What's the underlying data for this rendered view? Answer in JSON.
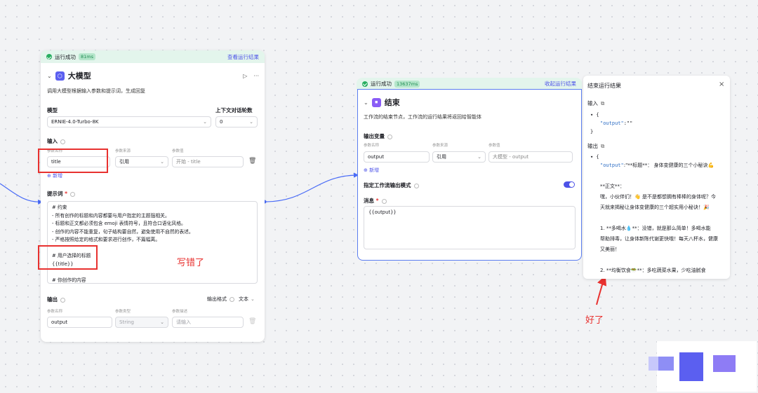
{
  "llm_node": {
    "status": "运行成功",
    "time": "81ms",
    "view_result": "查看运行结果",
    "title": "大模型",
    "description": "调用大模型根据输入参数和提示词，生成回复",
    "model_label": "模型",
    "model_value": "ERNIE-4.0-Turbo-8K",
    "context_label": "上下文对话轮数",
    "context_value": "0",
    "input_label": "输入",
    "col_name": "参数名称",
    "col_source": "参数来源",
    "col_value": "参数值",
    "input_param": "title",
    "input_source": "引用",
    "input_ref": "开始 - title",
    "add_label": "新增",
    "prompt_label": "提示词",
    "prompt_lines": [
      "# 约束",
      "- 所有创作的标题和内容都要与用户指定的主题强相关。",
      "- 标题和正文都必须包含 emoji 表情符号，且符合口语化风格。",
      "- 创作的内容不能重复，句子结构要自然，避免使用不自然的表述。",
      "- 严格按照给定的格式和要求进行创作，不篇幅离。",
      "",
      "# 用户选择的标题",
      "{{title}}",
      "",
      "# 你创作的内容"
    ],
    "output_label": "输出",
    "output_format_label": "输出格式",
    "output_format_value": "文本",
    "col_type": "参数类型",
    "col_desc": "参数描述",
    "output_param": "output",
    "output_type": "String",
    "output_desc_placeholder": "请输入"
  },
  "end_node": {
    "status": "运行成功",
    "time": "13637ms",
    "collapse_result": "收起运行结果",
    "title": "结束",
    "description": "工作流的结束节点，工作流的运行结果将返回给智能体",
    "output_var_label": "输出变量",
    "col_name": "参数名称",
    "col_source": "参数来源",
    "col_value": "参数值",
    "param": "output",
    "source": "引用",
    "ref": "大模型 - output",
    "add_label": "新增",
    "stream_label": "指定工作流输出模式",
    "stream_on": true,
    "message_label": "消息",
    "message_value": "{{output}}"
  },
  "result_panel": {
    "title": "结束运行结果",
    "input_label": "输入",
    "input_key": "\"output\"",
    "input_val": ":\"\"",
    "output_label": "输出",
    "output_key": "\"output\"",
    "output_val": ":\"**标题**：  身体变健康的三个小秘诀💪",
    "lines": [
      "**正文**：",
      "嘿，小伙伴们！👋 是不是都想拥有棒棒的身体呢？今",
      "天就来揭秘让身体变健康的三个超实用小秘诀！🎉",
      "",
      "1. **多喝水💧**：没错，就是那么简单！多喝水能",
      "帮助排毒，让身体新陈代谢更快哦！每天八杯水，健康",
      "又美丽！",
      "",
      "2. **均衡饮食🥗**：多吃蔬菜水果，少吃油腻食"
    ]
  },
  "annotations": {
    "wrong": "写错了",
    "good": "好了"
  },
  "colors": {
    "accent": "#4d53e8",
    "success_bg": "#e3f5ec",
    "annotation": "#e8312f"
  }
}
